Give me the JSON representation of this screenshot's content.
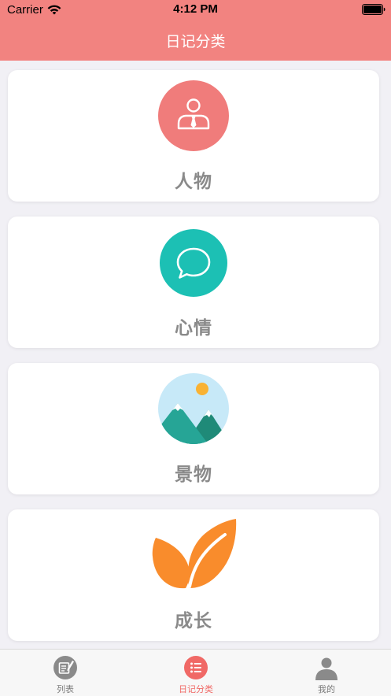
{
  "status_bar": {
    "carrier": "Carrier",
    "time": "4:12 PM",
    "wifi_icon": "wifi-icon",
    "battery_icon": "battery-icon"
  },
  "header": {
    "title": "日记分类",
    "background_color": "#f28380"
  },
  "categories": [
    {
      "label": "人物",
      "icon": "person-tie-icon",
      "color": "#f07c7b"
    },
    {
      "label": "心情",
      "icon": "chat-bubble-icon",
      "color": "#1cc0b4"
    },
    {
      "label": "景物",
      "icon": "mountain-sun-icon",
      "color": "#c7e9f8"
    },
    {
      "label": "成长",
      "icon": "leaf-icon",
      "color": "#f98c2c"
    }
  ],
  "tab_bar": {
    "active_color": "#f06966",
    "tabs": [
      {
        "label": "列表",
        "icon": "notebook-pen-icon",
        "active": false
      },
      {
        "label": "日记分类",
        "icon": "list-icon",
        "active": true
      },
      {
        "label": "我的",
        "icon": "user-icon",
        "active": false
      }
    ]
  }
}
